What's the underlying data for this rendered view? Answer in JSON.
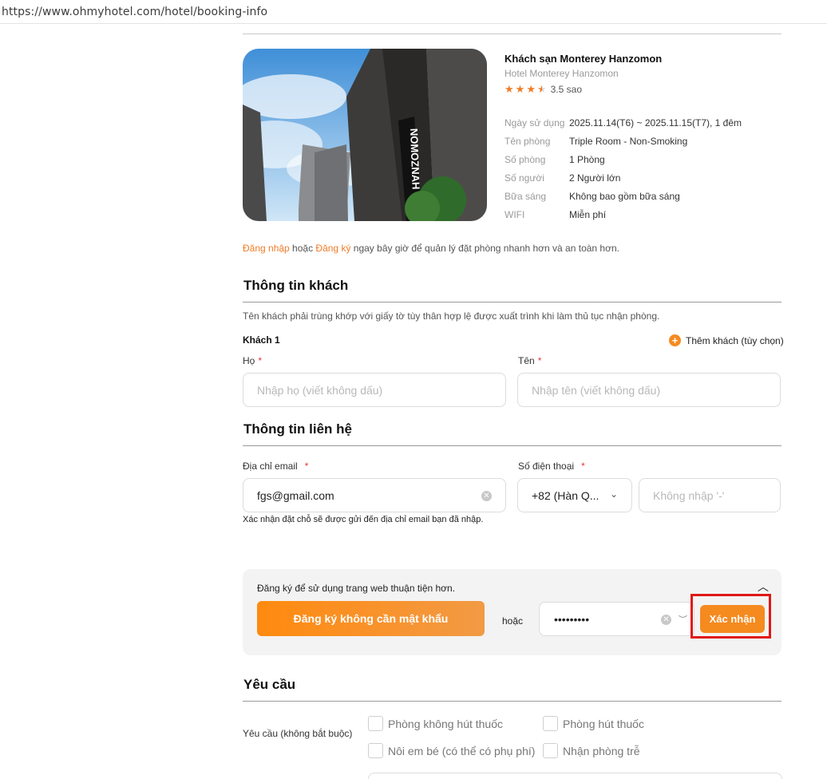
{
  "browser": {
    "url": "https://www.ohmyhotel.com/hotel/booking-info"
  },
  "hotel": {
    "name": "Khách sạn Monterey Hanzomon",
    "sub_name": "Hotel Monterey Hanzomon",
    "rating_text": "3.5 sao",
    "rating": 3.5,
    "image_sign_text": "NOMOZNAH",
    "details": [
      {
        "key": "Ngày sử dụng",
        "value": "2025.11.14(T6) ~ 2025.11.15(T7), 1 đêm"
      },
      {
        "key": "Tên phòng",
        "value": "Triple Room - Non-Smoking"
      },
      {
        "key": "Số phòng",
        "value": "1 Phòng"
      },
      {
        "key": "Số người",
        "value": "2 Người lớn"
      },
      {
        "key": "Bữa sáng",
        "value": "Không bao gồm bữa sáng"
      },
      {
        "key": "WIFI",
        "value": "Miễn phí"
      }
    ]
  },
  "login_prompt": {
    "login_link": "Đăng nhập",
    "or_text": " hoặc ",
    "register_link": "Đăng ký",
    "rest": " ngay bây giờ để quản lý đặt phòng nhanh hơn và an toàn hơn."
  },
  "guest_info": {
    "title": "Thông tin khách",
    "note": "Tên khách phải trùng khớp với giấy tờ tùy thân hợp lệ được xuất trình khi làm thủ tục nhận phòng.",
    "guest_label": "Khách 1",
    "add_guest": "Thêm khách (tùy chọn)",
    "last_name_label": "Họ",
    "last_name_placeholder": "Nhập họ (viết không dấu)",
    "first_name_label": "Tên",
    "first_name_placeholder": "Nhập tên (viết không dấu)",
    "required_mark": "*"
  },
  "contact_info": {
    "title": "Thông tin liên hệ",
    "email_label": "Địa chỉ email",
    "email_value": "fgs@gmail.com",
    "phone_label": "Số điện thoại",
    "country_code": "+82 (Hàn Q...",
    "phone_placeholder": "Không nhập '-'",
    "email_note": "Xác nhận đặt chỗ sẽ được gửi đến địa chỉ email bạn đã nhập."
  },
  "signup": {
    "message": "Đăng ký để sử dụng trang web thuận tiện hơn.",
    "signup_button": "Đăng ký không cần mật khẩu",
    "or_text": "hoặc",
    "password_value": "•••••••••",
    "confirm_button": "Xác nhận"
  },
  "requests": {
    "title": "Yêu cầu",
    "label": "Yêu cầu (không bắt buộc)",
    "options": [
      "Phòng không hút thuốc",
      "Phòng hút thuốc",
      "Nôi em bé (có thể có phụ phí)",
      "Nhận phòng trễ"
    ]
  },
  "colors": {
    "accent": "#f58a1f",
    "link": "#f07c28",
    "highlight": "#e01818"
  }
}
